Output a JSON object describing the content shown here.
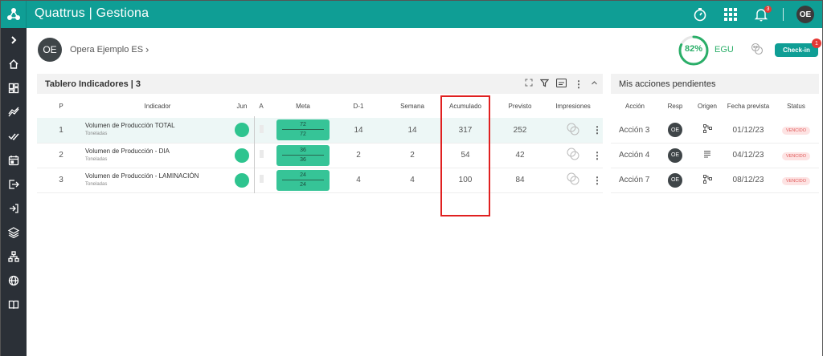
{
  "topbar": {
    "brand": "Quattrus | Gestiona",
    "notifications_count": "3",
    "user_initials": "OE"
  },
  "sidebar": {
    "items": [
      "expand-icon",
      "home-icon",
      "dashboard-icon",
      "trend-icon",
      "check-double-icon",
      "calendar-icon",
      "logout-icon",
      "exit-icon",
      "layers-icon",
      "org-chart-icon",
      "globe-icon",
      "book-icon"
    ]
  },
  "org": {
    "initials": "OE",
    "name": "Opera Ejemplo ES"
  },
  "score": {
    "percent": "82%",
    "percent_value": 82,
    "label": "EGU",
    "checkin_label": "Check-in",
    "checkin_badge": "1"
  },
  "indicators": {
    "title": "Tablero Indicadores | 3",
    "columns": [
      "P",
      "Indicador",
      "Jun",
      "A",
      "Meta",
      "D-1",
      "Semana",
      "Acumulado",
      "Previsto",
      "Impresiones"
    ],
    "rows": [
      {
        "p": "1",
        "name": "Volumen de Producción TOTAL",
        "unit": "Toneladas",
        "meta_top": "72",
        "meta_bottom": "72",
        "d1": "14",
        "semana": "14",
        "acumulado": "317",
        "previsto": "252"
      },
      {
        "p": "2",
        "name": "Volumen de Producción - DIA",
        "unit": "Toneladas",
        "meta_top": "36",
        "meta_bottom": "36",
        "d1": "2",
        "semana": "2",
        "acumulado": "54",
        "previsto": "42"
      },
      {
        "p": "3",
        "name": "Volumen de Producción - LAMINACIÓN",
        "unit": "Toneladas",
        "meta_top": "24",
        "meta_bottom": "24",
        "d1": "4",
        "semana": "4",
        "acumulado": "100",
        "previsto": "84"
      }
    ]
  },
  "actions": {
    "title": "Mis acciones pendientes",
    "columns": [
      "Acción",
      "Resp",
      "Origen",
      "Fecha prevista",
      "Status"
    ],
    "rows": [
      {
        "name": "Acción 3",
        "resp": "OE",
        "origen_icon": "flowchart-icon",
        "fecha": "01/12/23",
        "status": "VENCIDO"
      },
      {
        "name": "Acción 4",
        "resp": "OE",
        "origen_icon": "list-icon",
        "fecha": "04/12/23",
        "status": "VENCIDO"
      },
      {
        "name": "Acción 7",
        "resp": "OE",
        "origen_icon": "flowchart-icon",
        "fecha": "08/12/23",
        "status": "VENCIDO"
      }
    ]
  },
  "colors": {
    "brand": "#0f9e95",
    "sidebar": "#2b3037",
    "meta_green": "#36c497",
    "status_red": "#e05a5a",
    "highlight": "#e02020"
  }
}
